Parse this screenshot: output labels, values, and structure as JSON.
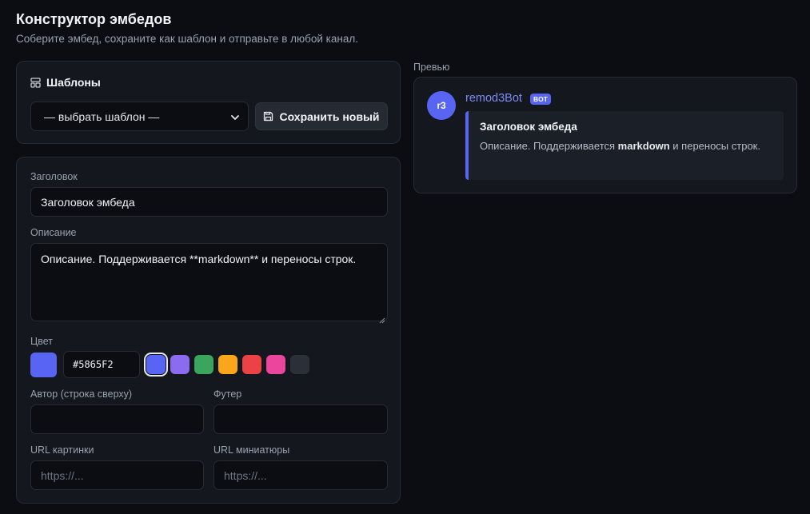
{
  "header": {
    "title": "Конструктор эмбедов",
    "subtitle": "Соберите эмбед, сохраните как шаблон и отправьте в любой канал."
  },
  "templates": {
    "title": "Шаблоны",
    "select_value": "— выбрать шаблон —",
    "save_label": "Сохранить новый"
  },
  "form": {
    "title_label": "Заголовок",
    "title_value": "Заголовок эмбеда",
    "description_label": "Описание",
    "description_value": "Описание. Поддерживается **markdown** и переносы строк.",
    "color_label": "Цвет",
    "color_hex": "#5865F2",
    "presets": [
      "#5865F2",
      "#8b6cf0",
      "#3ba55d",
      "#faa61a",
      "#ed4245",
      "#eb459e",
      "#2b2f38"
    ],
    "author_label": "Автор (строка сверху)",
    "footer_label": "Футер",
    "image_url_label": "URL картинки",
    "image_url_placeholder": "https://...",
    "thumbnail_url_label": "URL миниатюры",
    "thumbnail_url_placeholder": "https://..."
  },
  "preview": {
    "label": "Превью",
    "avatar_text": "r3",
    "bot_name": "remod3Bot",
    "bot_badge": "BOT",
    "embed_title": "Заголовок эмбеда",
    "embed_desc_before": "Описание. Поддерживается ",
    "embed_desc_bold": "markdown",
    "embed_desc_after": " и переносы строк."
  },
  "colors": {
    "accent": "#5865F2",
    "background": "#0b0d12",
    "card": "#14171e"
  }
}
